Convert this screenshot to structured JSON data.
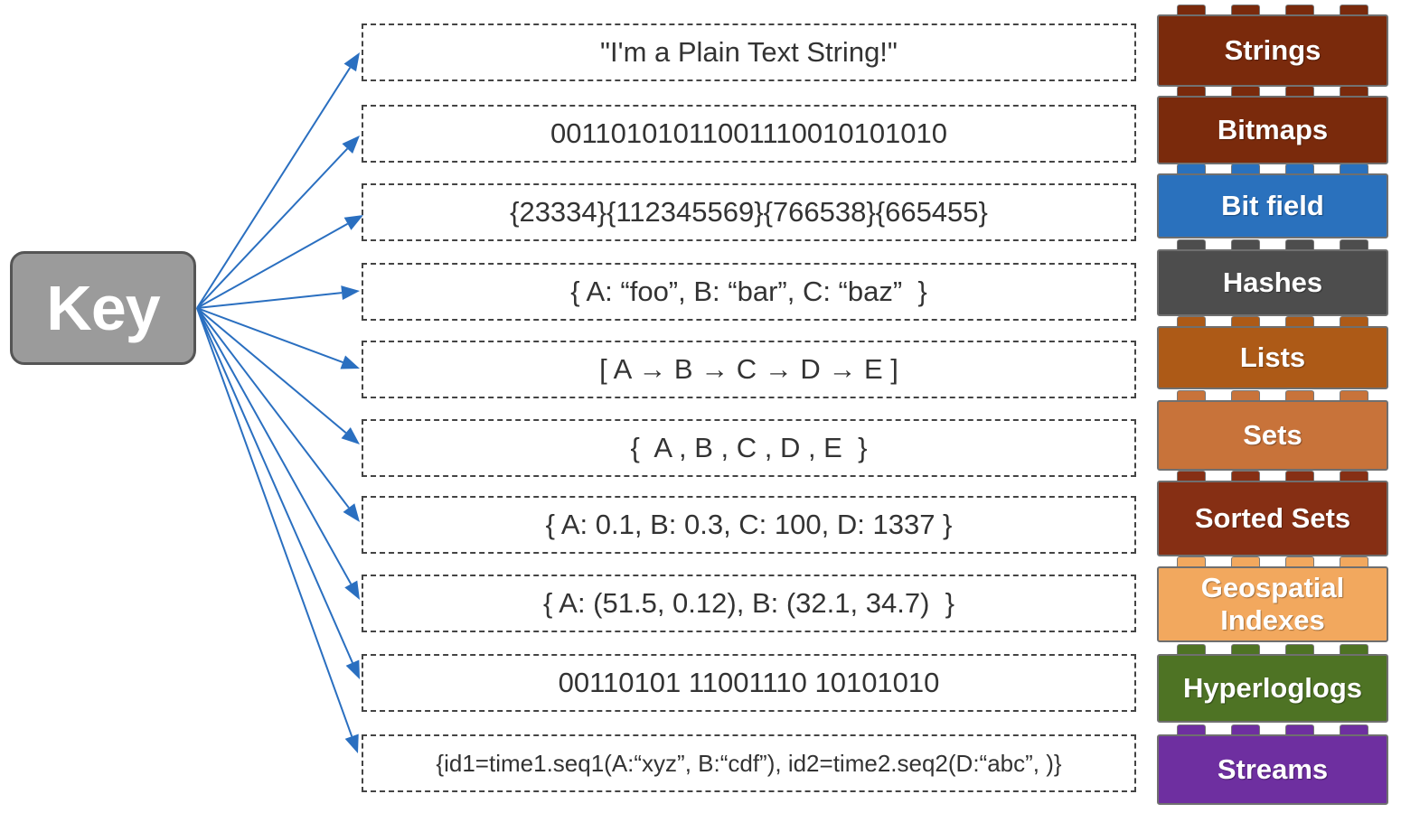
{
  "key": {
    "label": "Key",
    "color": "#9b9b9b"
  },
  "arrow_color": "#2a6fc0",
  "rows": [
    {
      "value": "\"I'm a Plain Text String!\"",
      "type": "Strings",
      "color": "#7a2a0c"
    },
    {
      "value": "00110101011001110010101010",
      "type": "Bitmaps",
      "color": "#7a2a0c"
    },
    {
      "value": "{23334}{112345569}{766538}{665455}",
      "type": "Bit field",
      "color": "#2a71bd"
    },
    {
      "value": "{ A: “foo”, B: “bar”, C: “baz”  }",
      "type": "Hashes",
      "color": "#4d4d4d"
    },
    {
      "value": "[ A → B → C → D → E ]",
      "type": "Lists",
      "color": "#ad5a17"
    },
    {
      "value": "{  A , B , C , D , E  }",
      "type": "Sets",
      "color": "#c8733a"
    },
    {
      "value": "{ A: 0.1, B: 0.3, C: 100, D: 1337 }",
      "type": "Sorted Sets",
      "color": "#862f14"
    },
    {
      "value": "{ A: (51.5, 0.12), B: (32.1, 34.7)  }",
      "type": "Geospatial Indexes",
      "color": "#f2a85e"
    },
    {
      "value": "00110101 11001110 10101010",
      "type": "Hyperloglogs",
      "color": "#4e7324"
    },
    {
      "value": "{id1=time1.seq1(A:“xyz”, B:“cdf”), id2=time2.seq2(D:“abc”, )}",
      "type": "Streams",
      "color": "#6e2fa0"
    }
  ]
}
